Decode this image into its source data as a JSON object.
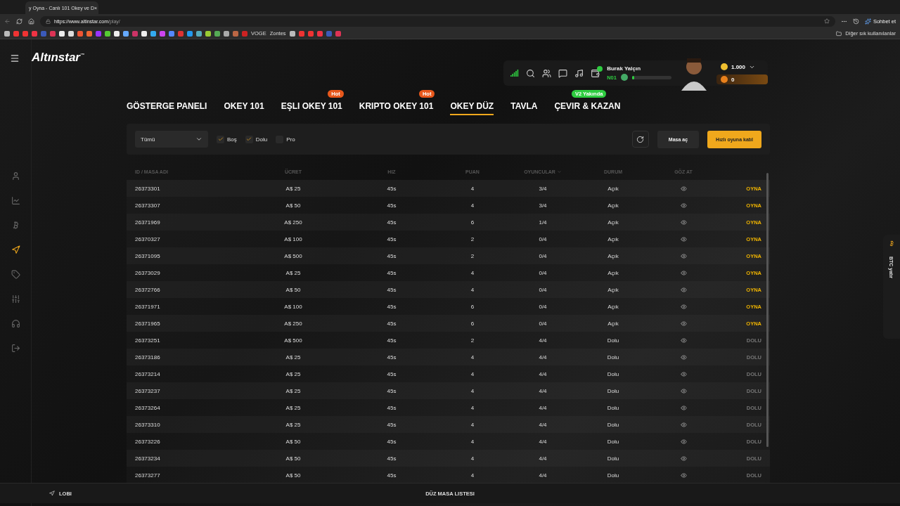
{
  "browser": {
    "tab_title": "y Oyna - Canlı 101 Okey ve D",
    "url_host": "https://www.altinstar.com",
    "url_path": "/play/",
    "tab_close": "×",
    "bookmark_texts": [
      "VOGE",
      "Zontes"
    ],
    "other_favorites": "Diğer sık kullanılanlar",
    "copilot": "Sohbet et"
  },
  "header": {
    "logo": "Altınstar",
    "logo_mark": "™",
    "user": {
      "name": "Burak Yalçın",
      "rank": "N01",
      "level": 0.05,
      "online": true
    },
    "balance": {
      "gold": "1.000",
      "coin": "0"
    }
  },
  "nav_tabs": [
    {
      "label": "GÖSTERGE PANELI",
      "selected": false
    },
    {
      "label": "OKEY 101",
      "selected": false
    },
    {
      "label": "EŞLI OKEY 101",
      "selected": false,
      "badge": {
        "label": "Hot",
        "color": "#e8581c"
      }
    },
    {
      "label": "KRIPTO OKEY 101",
      "selected": false,
      "badge": {
        "label": "Hot",
        "color": "#e8581c"
      }
    },
    {
      "label": "OKEY DÜZ",
      "selected": true
    },
    {
      "label": "TAVLA",
      "selected": false
    },
    {
      "label": "ÇEVIR & KAZAN",
      "selected": false,
      "badge": {
        "label": "V2 Yakında",
        "color": "#2ecc40"
      }
    }
  ],
  "filters": {
    "dropdown": "Tümü",
    "checks": [
      {
        "label": "Boş",
        "checked": true
      },
      {
        "label": "Dolu",
        "checked": true
      },
      {
        "label": "Pro",
        "checked": false
      }
    ],
    "open_button": "Masa aç",
    "quick_button": "Hızlı oyuna katıl"
  },
  "table": {
    "columns": [
      "ID / MASA ADI",
      "ÜCRET",
      "HIZ",
      "PUAN",
      "OYUNCULAR",
      "DURUM",
      "GÖZ AT"
    ],
    "rows": [
      {
        "id": "26373301",
        "fee": "A$ 25",
        "speed": "45s",
        "points": "4",
        "players": "3/4",
        "status": "Açık",
        "action": "OYNA",
        "kind": "open"
      },
      {
        "id": "26373307",
        "fee": "A$ 50",
        "speed": "45s",
        "points": "4",
        "players": "3/4",
        "status": "Açık",
        "action": "OYNA",
        "kind": "open"
      },
      {
        "id": "26371969",
        "fee": "A$ 250",
        "speed": "45s",
        "points": "6",
        "players": "1/4",
        "status": "Açık",
        "action": "OYNA",
        "kind": "open"
      },
      {
        "id": "26370327",
        "fee": "A$ 100",
        "speed": "45s",
        "points": "2",
        "players": "0/4",
        "status": "Açık",
        "action": "OYNA",
        "kind": "open"
      },
      {
        "id": "26371095",
        "fee": "A$ 500",
        "speed": "45s",
        "points": "2",
        "players": "0/4",
        "status": "Açık",
        "action": "OYNA",
        "kind": "open"
      },
      {
        "id": "26373029",
        "fee": "A$ 25",
        "speed": "45s",
        "points": "4",
        "players": "0/4",
        "status": "Açık",
        "action": "OYNA",
        "kind": "open"
      },
      {
        "id": "26372766",
        "fee": "A$ 50",
        "speed": "45s",
        "points": "4",
        "players": "0/4",
        "status": "Açık",
        "action": "OYNA",
        "kind": "open"
      },
      {
        "id": "26371971",
        "fee": "A$ 100",
        "speed": "45s",
        "points": "6",
        "players": "0/4",
        "status": "Açık",
        "action": "OYNA",
        "kind": "open"
      },
      {
        "id": "26371965",
        "fee": "A$ 250",
        "speed": "45s",
        "points": "6",
        "players": "0/4",
        "status": "Açık",
        "action": "OYNA",
        "kind": "open"
      },
      {
        "id": "26373251",
        "fee": "A$ 500",
        "speed": "45s",
        "points": "2",
        "players": "4/4",
        "status": "Dolu",
        "action": "DOLU",
        "kind": "full"
      },
      {
        "id": "26373186",
        "fee": "A$ 25",
        "speed": "45s",
        "points": "4",
        "players": "4/4",
        "status": "Dolu",
        "action": "DOLU",
        "kind": "full"
      },
      {
        "id": "26373214",
        "fee": "A$ 25",
        "speed": "45s",
        "points": "4",
        "players": "4/4",
        "status": "Dolu",
        "action": "DOLU",
        "kind": "full"
      },
      {
        "id": "26373237",
        "fee": "A$ 25",
        "speed": "45s",
        "points": "4",
        "players": "4/4",
        "status": "Dolu",
        "action": "DOLU",
        "kind": "full"
      },
      {
        "id": "26373264",
        "fee": "A$ 25",
        "speed": "45s",
        "points": "4",
        "players": "4/4",
        "status": "Dolu",
        "action": "DOLU",
        "kind": "full"
      },
      {
        "id": "26373310",
        "fee": "A$ 25",
        "speed": "45s",
        "points": "4",
        "players": "4/4",
        "status": "Dolu",
        "action": "DOLU",
        "kind": "full"
      },
      {
        "id": "26373226",
        "fee": "A$ 50",
        "speed": "45s",
        "points": "4",
        "players": "4/4",
        "status": "Dolu",
        "action": "DOLU",
        "kind": "full"
      },
      {
        "id": "26373234",
        "fee": "A$ 50",
        "speed": "45s",
        "points": "4",
        "players": "4/4",
        "status": "Dolu",
        "action": "DOLU",
        "kind": "full"
      },
      {
        "id": "26373277",
        "fee": "A$ 50",
        "speed": "45s",
        "points": "4",
        "players": "4/4",
        "status": "Dolu",
        "action": "DOLU",
        "kind": "full"
      }
    ]
  },
  "side_tab": {
    "label": "BTC yatır"
  },
  "bottom_bar": {
    "left": "LOBI",
    "center": "DÜZ MASA LISTESI"
  }
}
